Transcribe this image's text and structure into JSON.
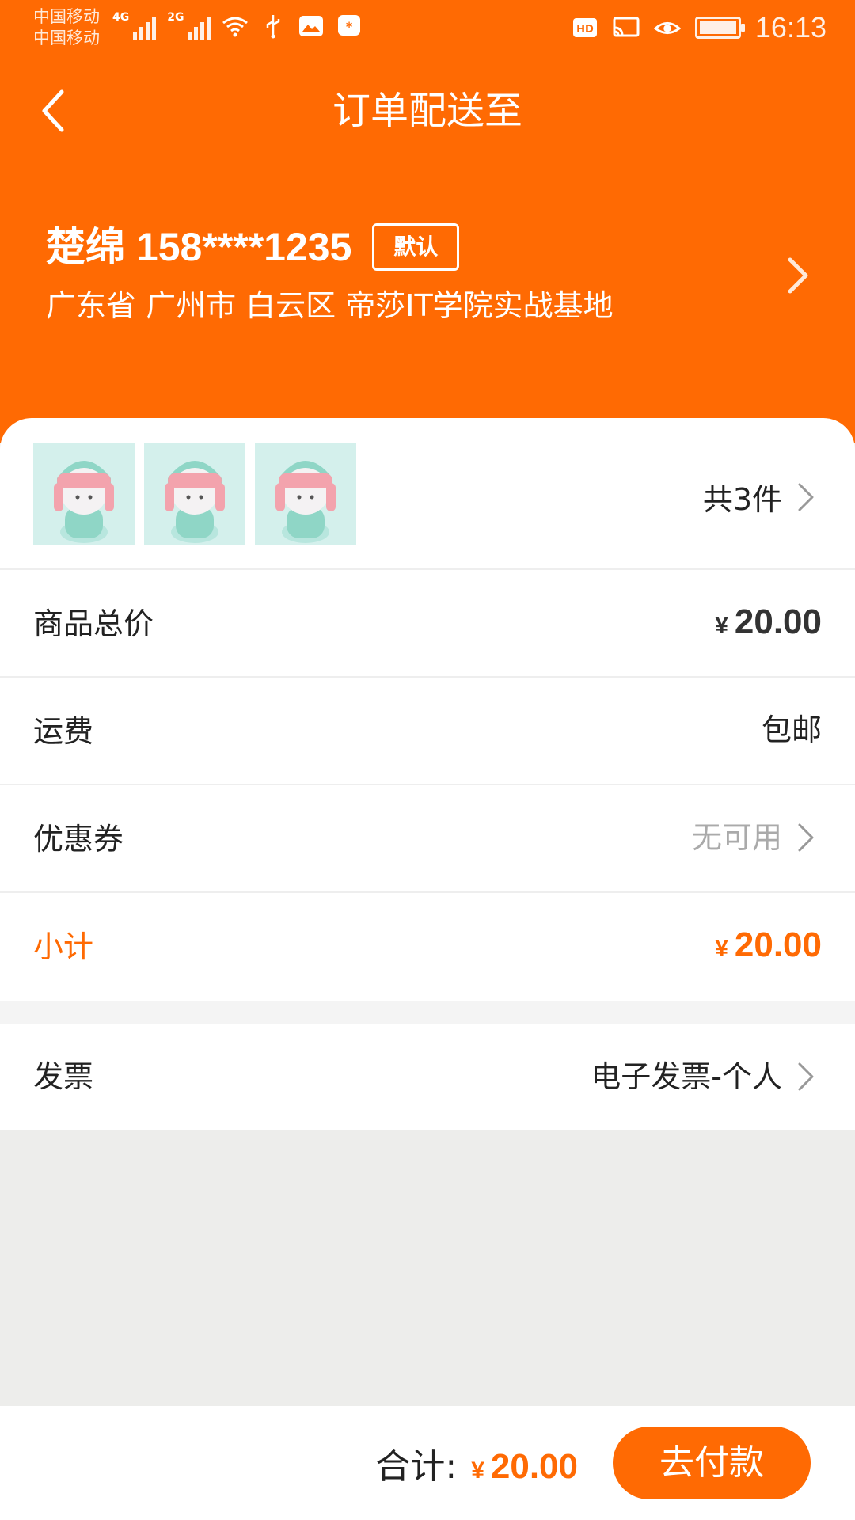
{
  "status_bar": {
    "carrier_1": "中国移动",
    "carrier_2": "中国移动",
    "net_1": "4G",
    "net_2": "2G",
    "time": "16:13"
  },
  "nav": {
    "title": "订单配送至"
  },
  "address": {
    "name_phone": "楚绵 158****1235",
    "default_badge": "默认",
    "line": "广东省 广州市 白云区 帝莎IT学院实战基地"
  },
  "products": {
    "count_label": "共3件",
    "thumbnails": [
      "product-thumbnail",
      "product-thumbnail",
      "product-thumbnail"
    ]
  },
  "summary": {
    "goods_total_label": "商品总价",
    "goods_total_currency": "¥",
    "goods_total_value": "20.00",
    "shipping_label": "运费",
    "shipping_value": "包邮",
    "coupon_label": "优惠券",
    "coupon_value": "无可用",
    "subtotal_label": "小计",
    "subtotal_currency": "¥",
    "subtotal_value": "20.00"
  },
  "invoice": {
    "label": "发票",
    "value": "电子发票-个人"
  },
  "footer": {
    "total_label": "合计:",
    "total_currency": "¥",
    "total_value": "20.00",
    "pay_button": "去付款"
  },
  "colors": {
    "accent": "#ff6a03",
    "background": "#ededeb"
  }
}
